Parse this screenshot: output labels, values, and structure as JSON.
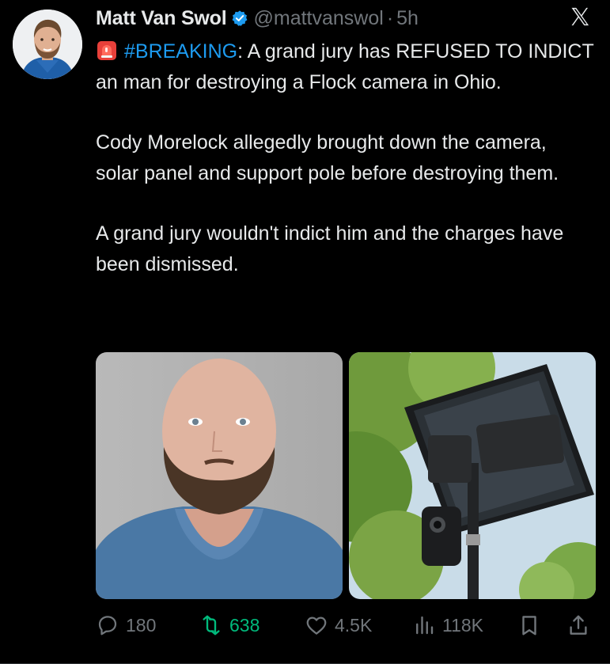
{
  "author": {
    "name": "Matt Van Swol",
    "handle": "@mattvanswol",
    "separator": "·",
    "time": "5h",
    "verified": true,
    "avatar_icon": "avatar-photo"
  },
  "post": {
    "line1_hashtag": "#BREAKING",
    "line1_rest": ": A grand jury has REFUSED TO INDICT an man for destroying a Flock camera in Ohio.",
    "para2": "Cody Morelock allegedly brought down the camera, solar panel and support pole before destroying them.",
    "para3": "A grand jury wouldn't indict him and the charges have been dismissed."
  },
  "media": [
    {
      "icon": "mugshot-photo"
    },
    {
      "icon": "flock-camera-photo"
    }
  ],
  "actions": {
    "replies": "180",
    "reposts": "638",
    "likes": "4.5K",
    "views": "118K"
  },
  "colors": {
    "background": "#000000",
    "text": "#e7e9ea",
    "muted": "#71767b",
    "link": "#1d9bf0",
    "repost_active": "#00ba7c",
    "verified": "#1d9bf0"
  }
}
